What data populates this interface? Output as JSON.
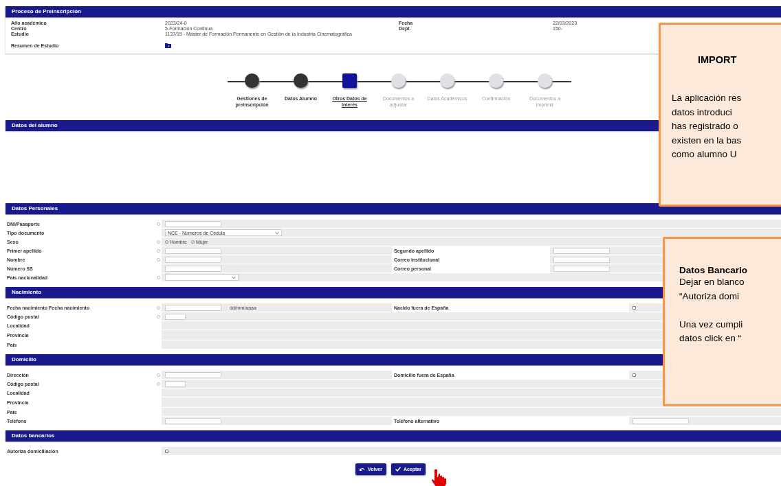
{
  "header": {
    "title": "Proceso de Preinscripción"
  },
  "info": {
    "left": [
      {
        "label": "Año académico",
        "value": "2023/24-0"
      },
      {
        "label": "Centro",
        "value": "5-Formación Continua"
      },
      {
        "label": "Estudio",
        "value": "1137/15 - Máster de Formación Permanente en Gestión de la Industria Cinematográfica"
      }
    ],
    "right": [
      {
        "label": "Fecha",
        "value": "22/03/2023"
      },
      {
        "label": "Dept.",
        "value": "150-"
      }
    ],
    "summary_label": "Resumen de Estudio"
  },
  "steps": [
    {
      "label": "Gestiones de preinscripción",
      "completed": true,
      "selected": false
    },
    {
      "label": "Datos Alumno",
      "completed": true,
      "selected": false
    },
    {
      "label": "Otros Datos de Interés",
      "completed": false,
      "selected": true
    },
    {
      "label": "Documentos a adjuntar",
      "completed": false,
      "selected": false
    },
    {
      "label": "Datos Académicos",
      "completed": false,
      "selected": false
    },
    {
      "label": "Confirmación",
      "completed": false,
      "selected": false
    },
    {
      "label": "Documentos a imprimir",
      "completed": false,
      "selected": false
    }
  ],
  "student_bar": {
    "title": "Datos del alumno"
  },
  "sections": [
    {
      "title": "Datos Personales",
      "rows": [
        {
          "label": "DNI/Pasaporte",
          "required": true,
          "field": {
            "kind": "text"
          }
        },
        {
          "label": "Tipo documento",
          "required": false,
          "field": {
            "kind": "select",
            "value": "NCE - Números de Cédula"
          }
        },
        {
          "label": "Sexo",
          "required": true,
          "field": {
            "kind": "radio",
            "options": [
              {
                "label": "Hombre",
                "selected": false
              },
              {
                "label": "Mujer",
                "selected": false
              }
            ]
          }
        },
        {
          "label": "Primer apellido",
          "required": true,
          "field": {
            "kind": "text"
          },
          "right": {
            "label": "Segundo apellido",
            "field": {
              "kind": "text"
            }
          }
        },
        {
          "label": "Nombre",
          "required": true,
          "field": {
            "kind": "text"
          },
          "right": {
            "label": "Correo institucional",
            "field": {
              "kind": "text"
            }
          }
        },
        {
          "label": "Número SS",
          "required": false,
          "field": {
            "kind": "text"
          },
          "right": {
            "label": "Correo personal",
            "field": {
              "kind": "text"
            }
          }
        },
        {
          "label": "País nacionalidad",
          "required": true,
          "field": {
            "kind": "select-short"
          }
        }
      ]
    },
    {
      "title": "Nacimiento",
      "rows": [
        {
          "label": "Fecha nacimiento Fecha nacimiento",
          "required": true,
          "field": {
            "kind": "date",
            "format": "dd/mm/aaaa"
          },
          "right": {
            "label": "Nacido fuera de España",
            "field": {
              "kind": "checkbox",
              "checked": false
            }
          }
        },
        {
          "label": "Código postal",
          "required": true,
          "field": {
            "kind": "short"
          }
        },
        {
          "label": "Localidad",
          "required": false
        },
        {
          "label": "Provincia",
          "required": false
        },
        {
          "label": "País",
          "required": false
        }
      ]
    },
    {
      "title": "Domicilio",
      "rows": [
        {
          "label": "Dirección",
          "required": true,
          "field": {
            "kind": "text"
          },
          "right": {
            "label": "Domicilio fuera de España",
            "field": {
              "kind": "checkbox",
              "checked": false
            }
          }
        },
        {
          "label": "Código postal",
          "required": true,
          "field": {
            "kind": "short"
          }
        },
        {
          "label": "Localidad",
          "required": false
        },
        {
          "label": "Provincia",
          "required": false
        },
        {
          "label": "País",
          "required": false
        },
        {
          "label": "Teléfono",
          "required": false,
          "field": {
            "kind": "text"
          },
          "right": {
            "label": "Teléfono alternativo",
            "field": {
              "kind": "text"
            }
          }
        }
      ]
    },
    {
      "title": "Datos bancarios",
      "rows": [
        {
          "label": "Autoriza domiciliación",
          "required": false,
          "field": {
            "kind": "checkbox",
            "checked": false
          }
        }
      ]
    }
  ],
  "buttons": [
    {
      "label": "Volver",
      "kind": "back"
    },
    {
      "label": "Aceptar",
      "kind": "accept"
    }
  ],
  "callouts": [
    {
      "title": "IMPORT",
      "paragraphs": [
        [
          "La aplicación res",
          "datos introduci",
          "has registrado o",
          "existen en la bas",
          "como alumno U"
        ]
      ]
    },
    {
      "title": "Datos Bancario",
      "paragraphs": [
        [
          "Dejar en blanco",
          "“Autoriza domi"
        ],
        [
          "Una vez cumpli",
          "datos click en “"
        ]
      ]
    }
  ]
}
